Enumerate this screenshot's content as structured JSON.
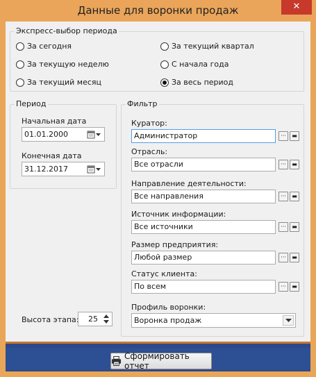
{
  "window": {
    "title": "Данные для воронки продаж",
    "close_glyph": "✕"
  },
  "express": {
    "title": "Экспресс-выбор периода",
    "options": [
      {
        "label": "За сегодня",
        "selected": false
      },
      {
        "label": "За текущий квартал",
        "selected": false
      },
      {
        "label": "За текущую неделю",
        "selected": false
      },
      {
        "label": "С начала года",
        "selected": false
      },
      {
        "label": "За текущий месяц",
        "selected": false
      },
      {
        "label": "За весь период",
        "selected": true
      }
    ]
  },
  "period": {
    "title": "Период",
    "start_label": "Начальная дата",
    "start_value": "01.01.2000",
    "end_label": "Конечная дата",
    "end_value": "31.12.2017"
  },
  "filter": {
    "title": "Фильтр",
    "fields": [
      {
        "label": "Куратор:",
        "value": "Администратор"
      },
      {
        "label": "Отрасль:",
        "value": "Все отрасли"
      },
      {
        "label": "Направление деятельности:",
        "value": "Все направления"
      },
      {
        "label": "Источник информации:",
        "value": "Все источники"
      },
      {
        "label": "Размер предприятия:",
        "value": "Любой размер"
      },
      {
        "label": "Статус клиента:",
        "value": "По всем"
      }
    ],
    "profile_label": "Профиль воронки:",
    "profile_value": "Воронка продаж"
  },
  "stage_height": {
    "label": "Высота этапа:",
    "value": "25"
  },
  "footer": {
    "report_button": "Сформировать отчет"
  },
  "colors": {
    "accent": "#e9a658",
    "footer": "#2d4f93",
    "close": "#c7392b"
  }
}
